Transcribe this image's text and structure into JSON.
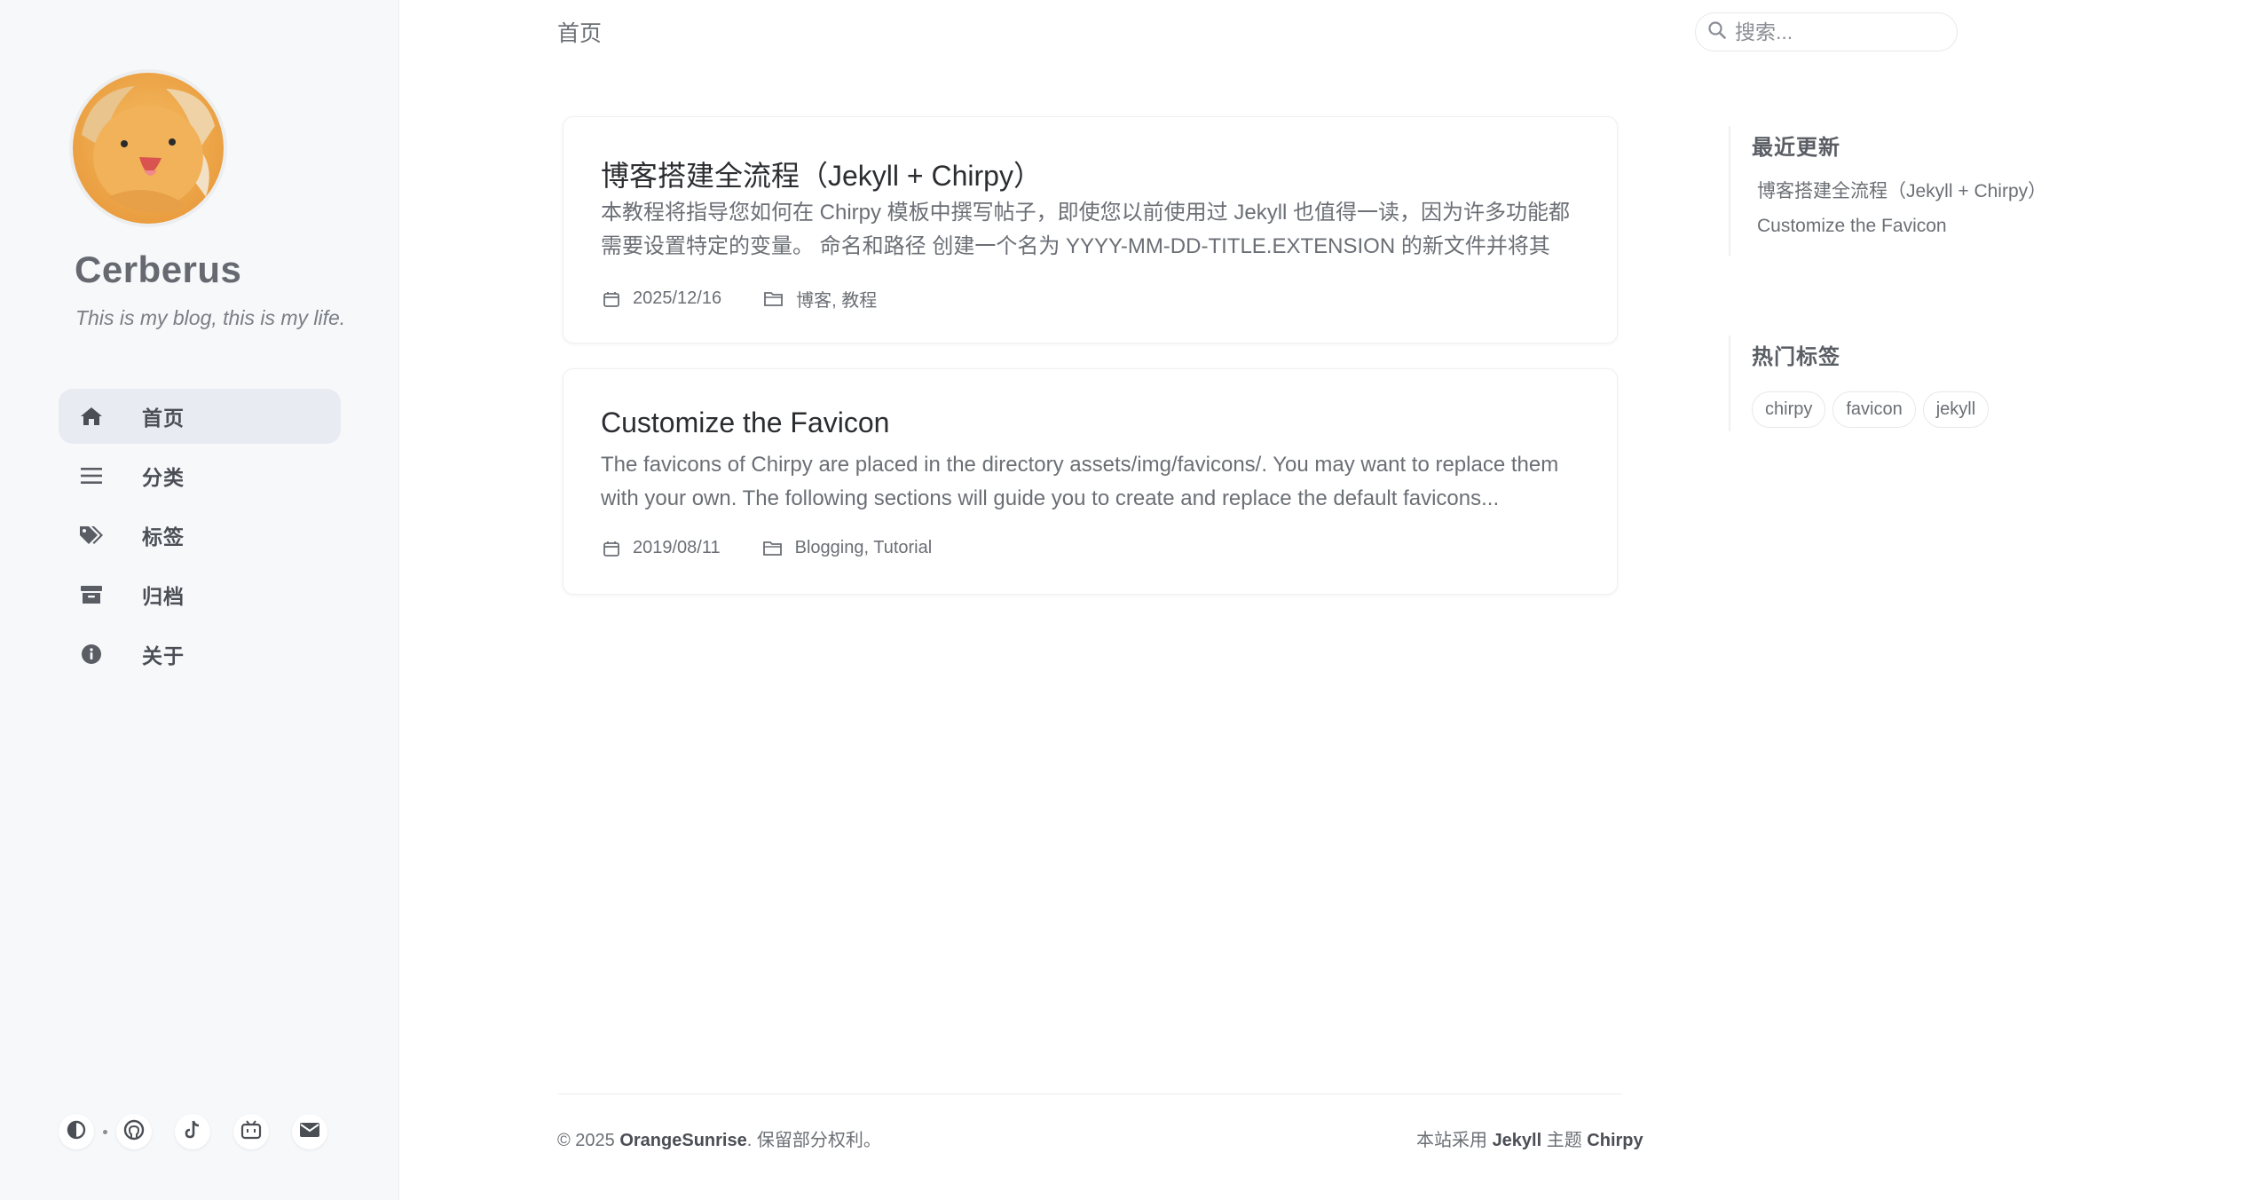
{
  "sidebar": {
    "site_title": "Cerberus",
    "subtitle": "This is my blog, this is my life.",
    "nav": [
      {
        "label": "首页",
        "icon": "home-icon",
        "active": true
      },
      {
        "label": "分类",
        "icon": "list-icon",
        "active": false
      },
      {
        "label": "标签",
        "icon": "tags-icon",
        "active": false
      },
      {
        "label": "归档",
        "icon": "archive-icon",
        "active": false
      },
      {
        "label": "关于",
        "icon": "info-icon",
        "active": false
      }
    ],
    "bottom_icons": [
      "theme-toggle-icon",
      "github-icon",
      "tiktok-icon",
      "bilibili-icon",
      "email-icon"
    ]
  },
  "topbar": {
    "breadcrumb": "首页",
    "search_placeholder": "搜索..."
  },
  "posts": [
    {
      "title": "博客搭建全流程（Jekyll + Chirpy）",
      "excerpt": "本教程将指导您如何在 Chirpy 模板中撰写帖子，即使您以前使用过 Jekyll 也值得一读，因为许多功能都需要设置特定的变量。 命名和路径 创建一个名为 YYYY-MM-DD-TITLE.EXTENSION 的新文件并将其放…",
      "date": "2025/12/16",
      "categories": "博客, 教程"
    },
    {
      "title": "Customize the Favicon",
      "excerpt": "The favicons of Chirpy are placed in the directory assets/img/favicons/. You may want to replace them with your own. The following sections will guide you to create and replace the default favicons...",
      "date": "2019/08/11",
      "categories": "Blogging, Tutorial"
    }
  ],
  "panel": {
    "recent_heading": "最近更新",
    "recent": [
      "博客搭建全流程（Jekyll + Chirpy）",
      "Customize the Favicon"
    ],
    "tags_heading": "热门标签",
    "tags": [
      "chirpy",
      "favicon",
      "jekyll"
    ]
  },
  "footer": {
    "left_prefix": "© 2025 ",
    "left_owner": "OrangeSunrise",
    "left_suffix": ". 保留部分权利。",
    "right_prefix": "本站采用 ",
    "right_jekyll": "Jekyll",
    "right_mid": " 主题 ",
    "right_chirpy": "Chirpy"
  },
  "colors": {
    "sidebar_bg": "#f6f8fa",
    "active_nav_bg": "#e8ebf1",
    "avatar_orange": "#f0a848"
  }
}
